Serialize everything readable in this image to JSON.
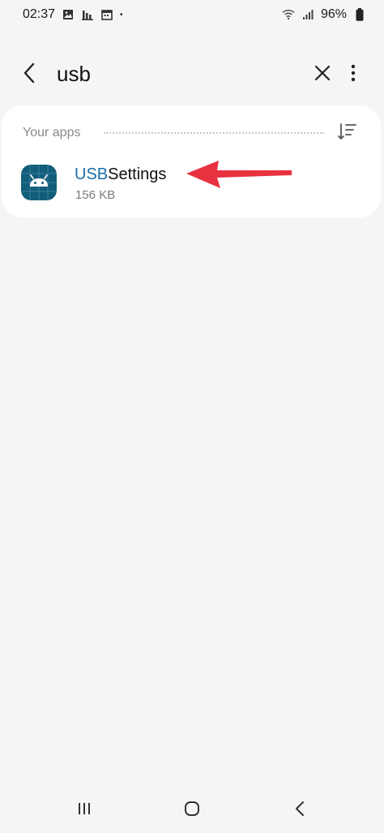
{
  "status_bar": {
    "time": "02:37",
    "dot": "•",
    "battery": "96%",
    "icons": [
      "image-icon",
      "chart-icon",
      "calendar-icon",
      "wifi-icon",
      "signal-icon",
      "battery-icon"
    ]
  },
  "search": {
    "query": "usb",
    "back_icon": "back-arrow-icon",
    "clear_icon": "close-icon",
    "more_icon": "more-vert-icon"
  },
  "results": {
    "section_label": "Your apps",
    "sort_icon": "sort-icon",
    "apps": [
      {
        "name_highlight": "USB",
        "name_rest": "Settings",
        "size": "156 KB",
        "icon": "android-icon"
      }
    ]
  },
  "annotation": {
    "arrow_color": "#e8323f"
  },
  "colors": {
    "highlight": "#1b6fa8",
    "app_icon_bg": "#125e7a",
    "background": "#f5f5f5"
  },
  "navbar": {
    "icons": [
      "recents-icon",
      "home-icon",
      "back-icon"
    ]
  }
}
